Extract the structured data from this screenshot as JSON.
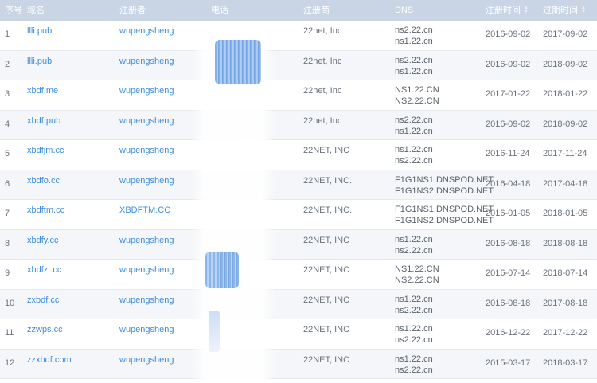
{
  "columns": {
    "num": "序号",
    "domain": "域名",
    "registrant": "注册者",
    "phone": "电话",
    "registrar": "注册商",
    "dns": "DNS",
    "created": "注册时间",
    "expires": "过期时间"
  },
  "rows": [
    {
      "num": "1",
      "domain": "llli.pub",
      "registrant": "wupengsheng",
      "registrar": "22net, Inc",
      "dns1": "ns2.22.cn",
      "dns2": "ns1.22.cn",
      "created": "2016-09-02",
      "expires": "2017-09-02"
    },
    {
      "num": "2",
      "domain": "llli.pub",
      "registrant": "wupengsheng",
      "registrar": "22net, Inc",
      "dns1": "ns2.22.cn",
      "dns2": "ns1.22.cn",
      "created": "2016-09-02",
      "expires": "2018-09-02"
    },
    {
      "num": "3",
      "domain": "xbdf.me",
      "registrant": "wupengsheng",
      "registrar": "22net, Inc",
      "dns1": "NS1.22.CN",
      "dns2": "NS2.22.CN",
      "created": "2017-01-22",
      "expires": "2018-01-22"
    },
    {
      "num": "4",
      "domain": "xbdf.pub",
      "registrant": "wupengsheng",
      "registrar": "22net, Inc",
      "dns1": "ns2.22.cn",
      "dns2": "ns1.22.cn",
      "created": "2016-09-02",
      "expires": "2018-09-02"
    },
    {
      "num": "5",
      "domain": "xbdfjm.cc",
      "registrant": "wupengsheng",
      "registrar": "22NET, INC",
      "dns1": "ns1.22.cn",
      "dns2": "ns2.22.cn",
      "created": "2016-11-24",
      "expires": "2017-11-24"
    },
    {
      "num": "6",
      "domain": "xbdfo.cc",
      "registrant": "wupengsheng",
      "registrar": "22NET, INC.",
      "dns1": "F1G1NS1.DNSPOD.NET",
      "dns2": "F1G1NS2.DNSPOD.NET",
      "created": "2016-04-18",
      "expires": "2017-04-18"
    },
    {
      "num": "7",
      "domain": "xbdftm.cc",
      "registrant": "XBDFTM.CC",
      "registrar": "22NET, INC.",
      "dns1": "F1G1NS1.DNSPOD.NET",
      "dns2": "F1G1NS2.DNSPOD.NET",
      "created": "2016-01-05",
      "expires": "2018-01-05"
    },
    {
      "num": "8",
      "domain": "xbdfy.cc",
      "registrant": "wupengsheng",
      "registrar": "22NET, INC",
      "dns1": "ns1.22.cn",
      "dns2": "ns2.22.cn",
      "created": "2016-08-18",
      "expires": "2018-08-18"
    },
    {
      "num": "9",
      "domain": "xbdfzt.cc",
      "registrant": "wupengsheng",
      "registrar": "22NET, INC",
      "dns1": "NS1.22.CN",
      "dns2": "NS2.22.CN",
      "created": "2016-07-14",
      "expires": "2018-07-14"
    },
    {
      "num": "10",
      "domain": "zxbdf.cc",
      "registrant": "wupengsheng",
      "registrar": "22NET, INC",
      "dns1": "ns1.22.cn",
      "dns2": "ns2.22.cn",
      "created": "2016-08-18",
      "expires": "2017-08-18"
    },
    {
      "num": "11",
      "domain": "zzwps.cc",
      "registrant": "wupengsheng",
      "registrar": "22NET, INC",
      "dns1": "ns1.22.cn",
      "dns2": "ns2.22.cn",
      "created": "2016-12-22",
      "expires": "2017-12-22"
    },
    {
      "num": "12",
      "domain": "zzxbdf.com",
      "registrant": "wupengsheng",
      "registrar": "22NET, INC",
      "dns1": "ns1.22.cn",
      "dns2": "ns2.22.cn",
      "created": "2015-03-17",
      "expires": "2018-03-17"
    }
  ],
  "colors": {
    "header_bg": "#c9d4e4",
    "link": "#3d8ee0",
    "alt_row": "#f4f6f9"
  },
  "icons": {
    "sort": "sort-arrows-icon"
  }
}
